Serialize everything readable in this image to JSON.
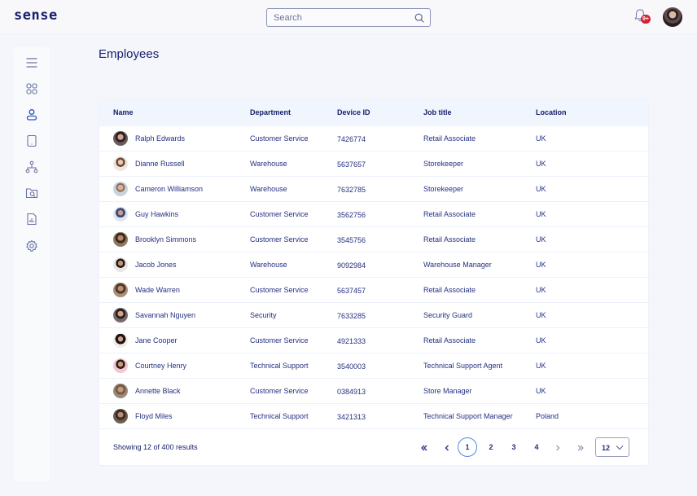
{
  "app": {
    "logo": "sense",
    "search": {
      "placeholder": "Search",
      "value": ""
    },
    "notifications": {
      "badge": "9+"
    }
  },
  "sidebar": {
    "items": [
      {
        "name": "menu",
        "icon": "hamburger-icon",
        "active": false
      },
      {
        "name": "dashboard",
        "icon": "grid-icon",
        "active": false
      },
      {
        "name": "employees",
        "icon": "user-icon",
        "active": true
      },
      {
        "name": "devices",
        "icon": "tablet-icon",
        "active": false
      },
      {
        "name": "organization",
        "icon": "hierarchy-icon",
        "active": false
      },
      {
        "name": "files",
        "icon": "folder-search-icon",
        "active": false
      },
      {
        "name": "reports",
        "icon": "report-icon",
        "active": false
      },
      {
        "name": "settings",
        "icon": "gear-icon",
        "active": false
      }
    ]
  },
  "page": {
    "title": "Employees"
  },
  "table": {
    "columns": [
      "Name",
      "Department",
      "Device ID",
      "Job title",
      "Location"
    ],
    "rows": [
      {
        "name": "Ralph Edwards",
        "department": "Customer Service",
        "device_id": "7426774",
        "job_title": "Retail Associate",
        "location": "UK"
      },
      {
        "name": "Dianne Russell",
        "department": "Warehouse",
        "device_id": "5637657",
        "job_title": "Storekeeper",
        "location": "UK"
      },
      {
        "name": "Cameron Williamson",
        "department": "Warehouse",
        "device_id": "7632785",
        "job_title": "Storekeeper",
        "location": "UK"
      },
      {
        "name": "Guy Hawkins",
        "department": "Customer Service",
        "device_id": "3562756",
        "job_title": "Retail Associate",
        "location": "UK"
      },
      {
        "name": "Brooklyn Simmons",
        "department": "Customer Service",
        "device_id": "3545756",
        "job_title": "Retail Associate",
        "location": "UK"
      },
      {
        "name": "Jacob Jones",
        "department": "Warehouse",
        "device_id": "9092984",
        "job_title": "Warehouse Manager",
        "location": "UK"
      },
      {
        "name": "Wade Warren",
        "department": "Customer Service",
        "device_id": "5637457",
        "job_title": "Retail Associate",
        "location": "UK"
      },
      {
        "name": "Savannah Nguyen",
        "department": "Security",
        "device_id": "7633285",
        "job_title": "Security Guard",
        "location": "UK"
      },
      {
        "name": "Jane Cooper",
        "department": "Customer Service",
        "device_id": "4921333",
        "job_title": "Retail Associate",
        "location": "UK"
      },
      {
        "name": "Courtney Henry",
        "department": "Technical Support",
        "device_id": "3540003",
        "job_title": "Technical Support Agent",
        "location": "UK"
      },
      {
        "name": "Annette Black",
        "department": "Customer Service",
        "device_id": "0384913",
        "job_title": "Store Manager",
        "location": "UK"
      },
      {
        "name": "Floyd Miles",
        "department": "Technical Support",
        "device_id": "3421313",
        "job_title": "Technical Support Manager",
        "location": "Poland"
      }
    ]
  },
  "footer": {
    "summary": "Showing 12 of 400 results",
    "pages": [
      "1",
      "2",
      "3",
      "4"
    ],
    "current_page": "1",
    "per_page": "12"
  },
  "colors": {
    "brand": "#17206b",
    "accent": "#4a8ae8",
    "active_icon": "#2a56b8",
    "badge": "#d3202f"
  }
}
